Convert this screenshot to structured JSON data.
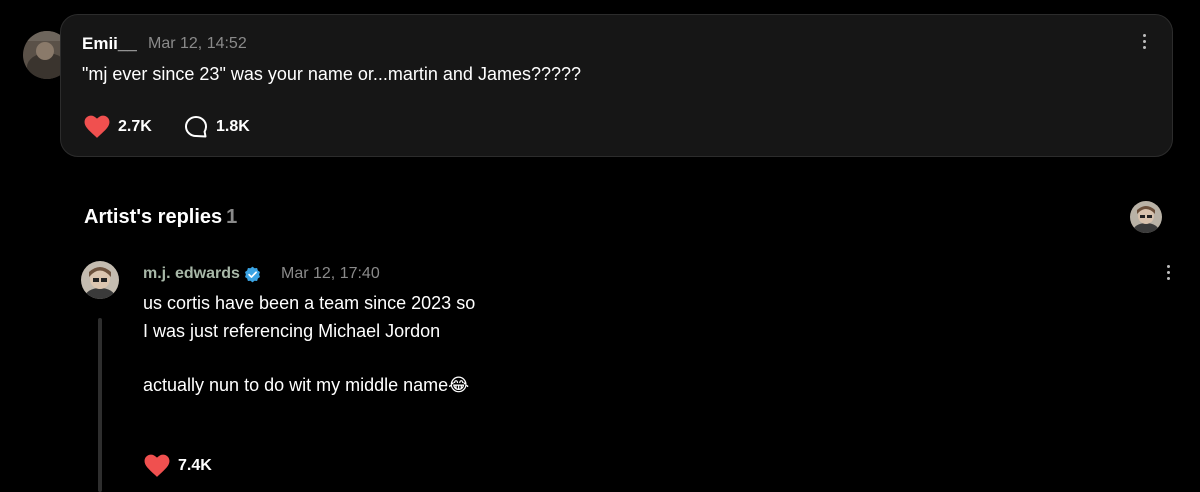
{
  "comment": {
    "author": "Emii__",
    "timestamp": "Mar 12, 14:52",
    "text": "\"mj ever since 23\" was your name or...martin and James?????",
    "likes": "2.7K",
    "replies": "1.8K"
  },
  "artist_replies": {
    "title": "Artist's replies",
    "count": "1"
  },
  "reply": {
    "author": "m.j. edwards",
    "timestamp": "Mar 12, 17:40",
    "line1": "us cortis have been a team since 2023 so",
    "line2": "I was just referencing Michael Jordon",
    "line3": "actually nun to do wit my middle name😂",
    "likes": "7.4K"
  },
  "colors": {
    "heart": "#f0504f",
    "verified": "#3aa3e3",
    "card_bg": "#161616",
    "muted_text": "#8a8a8a",
    "artist_name": "#a8b8a8"
  },
  "icons": {
    "like": "heart-icon",
    "comment": "speech-bubble-icon",
    "more": "more-vertical-icon",
    "verified": "verified-badge-icon"
  }
}
